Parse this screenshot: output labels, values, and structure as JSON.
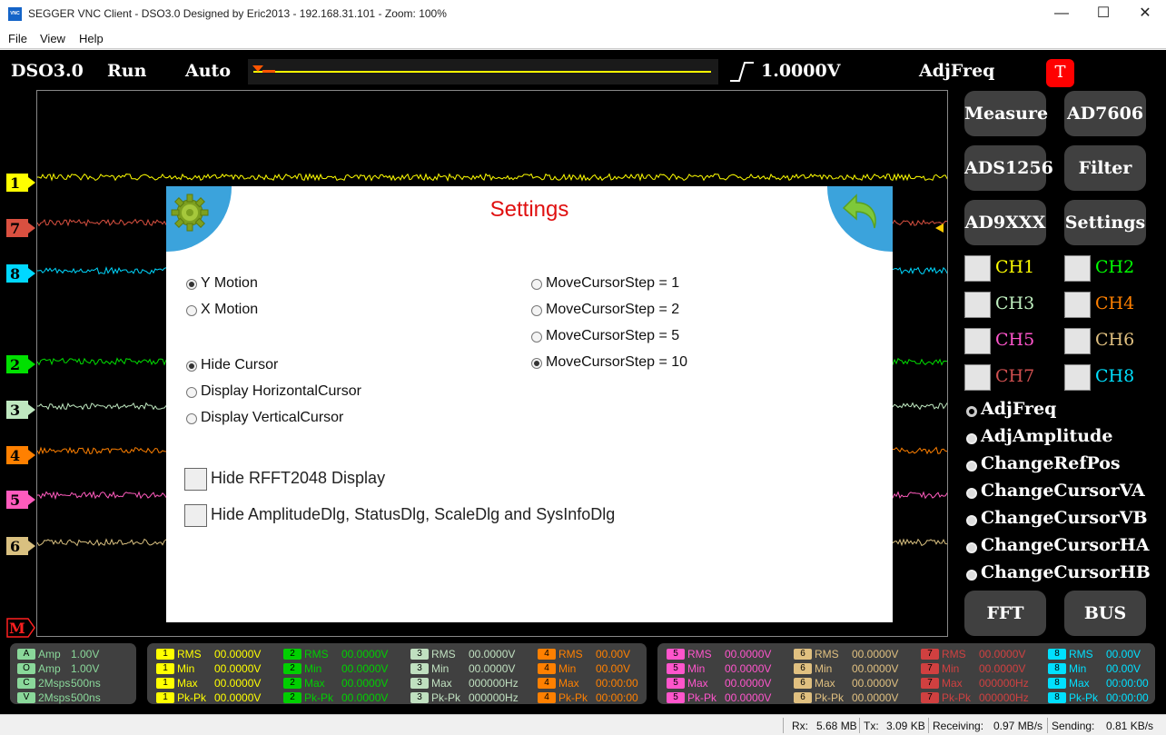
{
  "window": {
    "title": "SEGGER VNC Client - DSO3.0 Designed by Eric2013 - 192.168.31.101 - Zoom: 100%",
    "app_icon_label": "VNC",
    "minimize_icon": "minimize-icon",
    "maximize_icon": "maximize-icon",
    "close_icon": "close-icon"
  },
  "menu": {
    "file": "File",
    "view": "View",
    "help": "Help"
  },
  "header": {
    "app": "DSO3.0",
    "run": "Run",
    "mode": "Auto",
    "trigger_level": "1.0000V",
    "adjust": "AdjFreq",
    "trigger_badge": "T"
  },
  "channels": [
    {
      "id": "1",
      "color": "#ffff00"
    },
    {
      "id": "7",
      "color": "#d95040"
    },
    {
      "id": "8",
      "color": "#00d8ff"
    },
    {
      "id": "2",
      "color": "#00e000"
    },
    {
      "id": "3",
      "color": "#bfe8c0"
    },
    {
      "id": "4",
      "color": "#ff8000"
    },
    {
      "id": "5",
      "color": "#ff5bbd"
    },
    {
      "id": "6",
      "color": "#d9c080"
    }
  ],
  "math_marker": "M",
  "right_panel": {
    "buttons": [
      "Measure",
      "AD7606",
      "ADS1256",
      "Filter",
      "AD9XXX",
      "Settings"
    ],
    "channel_toggles": [
      {
        "label": "CH1",
        "color": "#ffff00"
      },
      {
        "label": "CH2",
        "color": "#00ff00"
      },
      {
        "label": "CH3",
        "color": "#c0f0c0"
      },
      {
        "label": "CH4",
        "color": "#ff8000"
      },
      {
        "label": "CH5",
        "color": "#ff55cc"
      },
      {
        "label": "CH6",
        "color": "#e0c080"
      },
      {
        "label": "CH7",
        "color": "#d05050"
      },
      {
        "label": "CH8",
        "color": "#00e0ff"
      }
    ],
    "modes": [
      "AdjFreq",
      "AdjAmplitude",
      "ChangeRefPos",
      "ChangeCursorVA",
      "ChangeCursorVB",
      "ChangeCursorHA",
      "ChangeCursorHB"
    ],
    "selected_mode": "AdjFreq",
    "bottom_buttons": [
      "FFT",
      "BUS"
    ]
  },
  "settings_dialog": {
    "title": "Settings",
    "gear_icon": "gear-icon",
    "back_icon": "back-arrow-icon",
    "motion_options": [
      "Y Motion",
      "X Motion"
    ],
    "motion_selected": "Y Motion",
    "cursor_options": [
      "Hide Cursor",
      "Display HorizontalCursor",
      "Display VerticalCursor"
    ],
    "cursor_selected": "Hide Cursor",
    "step_options": [
      "MoveCursorStep = 1",
      "MoveCursorStep = 2",
      "MoveCursorStep = 5",
      "MoveCursorStep = 10"
    ],
    "step_selected": "MoveCursorStep = 10",
    "checkboxes": [
      "Hide RFFT2048 Display",
      "Hide AmplitudeDlg, StatusDlg, ScaleDlg and SysInfoDlg"
    ]
  },
  "info_panel_left": [
    {
      "badge": "A",
      "label": "Amp",
      "value": "1.00V"
    },
    {
      "badge": "O",
      "label": "Amp",
      "value": "1.00V"
    },
    {
      "badge": "C",
      "label": "2Msps",
      "value": "500ns"
    },
    {
      "badge": "V",
      "label": "2Msps",
      "value": "500ns"
    }
  ],
  "measure_panel_1": [
    {
      "ch": "1",
      "color": "#ffff00",
      "rows": [
        [
          "RMS",
          "00.0000V"
        ],
        [
          "Min",
          "00.0000V"
        ],
        [
          "Max",
          "00.0000V"
        ],
        [
          "Pk-Pk",
          "00.0000V"
        ]
      ]
    },
    {
      "ch": "2",
      "color": "#00d000",
      "rows": [
        [
          "RMS",
          "00.0000V"
        ],
        [
          "Min",
          "00.0000V"
        ],
        [
          "Max",
          "00.0000V"
        ],
        [
          "Pk-Pk",
          "00.0000V"
        ]
      ]
    },
    {
      "ch": "3",
      "color": "#c0e0c0",
      "rows": [
        [
          "RMS",
          "00.0000V"
        ],
        [
          "Min",
          "00.0000V"
        ],
        [
          "Max",
          "000000Hz"
        ],
        [
          "Pk-Pk",
          "000000Hz"
        ]
      ]
    },
    {
      "ch": "4",
      "color": "#ff8000",
      "rows": [
        [
          "RMS",
          "00.00V"
        ],
        [
          "Min",
          "00.00V"
        ],
        [
          "Max",
          "00:00:00"
        ],
        [
          "Pk-Pk",
          "00:00:00"
        ]
      ]
    }
  ],
  "measure_panel_2": [
    {
      "ch": "5",
      "color": "#ff55cc",
      "rows": [
        [
          "RMS",
          "00.0000V"
        ],
        [
          "Min",
          "00.0000V"
        ],
        [
          "Max",
          "00.0000V"
        ],
        [
          "Pk-Pk",
          "00.0000V"
        ]
      ]
    },
    {
      "ch": "6",
      "color": "#e0c080",
      "rows": [
        [
          "RMS",
          "00.0000V"
        ],
        [
          "Min",
          "00.0000V"
        ],
        [
          "Max",
          "00.0000V"
        ],
        [
          "Pk-Pk",
          "00.0000V"
        ]
      ]
    },
    {
      "ch": "7",
      "color": "#d04040",
      "rows": [
        [
          "RMS",
          "00.0000V"
        ],
        [
          "Min",
          "00.0000V"
        ],
        [
          "Max",
          "000000Hz"
        ],
        [
          "Pk-Pk",
          "000000Hz"
        ]
      ]
    },
    {
      "ch": "8",
      "color": "#00e0ff",
      "rows": [
        [
          "RMS",
          "00.00V"
        ],
        [
          "Min",
          "00.00V"
        ],
        [
          "Max",
          "00:00:00"
        ],
        [
          "Pk-Pk",
          "00:00:00"
        ]
      ]
    }
  ],
  "statusbar": {
    "rx_label": "Rx:",
    "rx": "5.68 MB",
    "tx_label": "Tx:",
    "tx": "3.09 KB",
    "recv_label": "Receiving:",
    "recv": "0.97 MB/s",
    "send_label": "Sending:",
    "send": "0.81 KB/s"
  }
}
